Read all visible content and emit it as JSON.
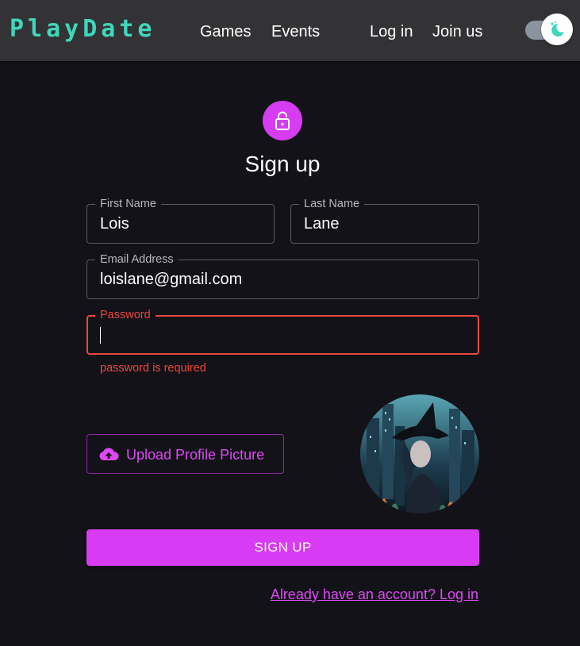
{
  "header": {
    "logo": "PlayDate",
    "nav": {
      "games": "Games",
      "events": "Events",
      "login": "Log in",
      "join": "Join us"
    },
    "theme_toggle": {
      "state": "dark",
      "icon": "moon-stars-icon"
    }
  },
  "form": {
    "icon": "lock-icon",
    "title": "Sign up",
    "first_name": {
      "label": "First Name",
      "value": "Lois"
    },
    "last_name": {
      "label": "Last Name",
      "value": "Lane"
    },
    "email": {
      "label": "Email Address",
      "value": "loislane@gmail.com"
    },
    "password": {
      "label": "Password",
      "value": "",
      "error": "password is required"
    },
    "upload": {
      "label": "Upload Profile Picture",
      "icon": "cloud-upload-icon"
    },
    "submit": "SIGN UP",
    "login_link": "Already have an account? Log in"
  },
  "colors": {
    "background": "#131218",
    "header": "#333336",
    "logo": "#3fd7ba",
    "accent": "#d93bf4",
    "error": "#e9483d"
  }
}
